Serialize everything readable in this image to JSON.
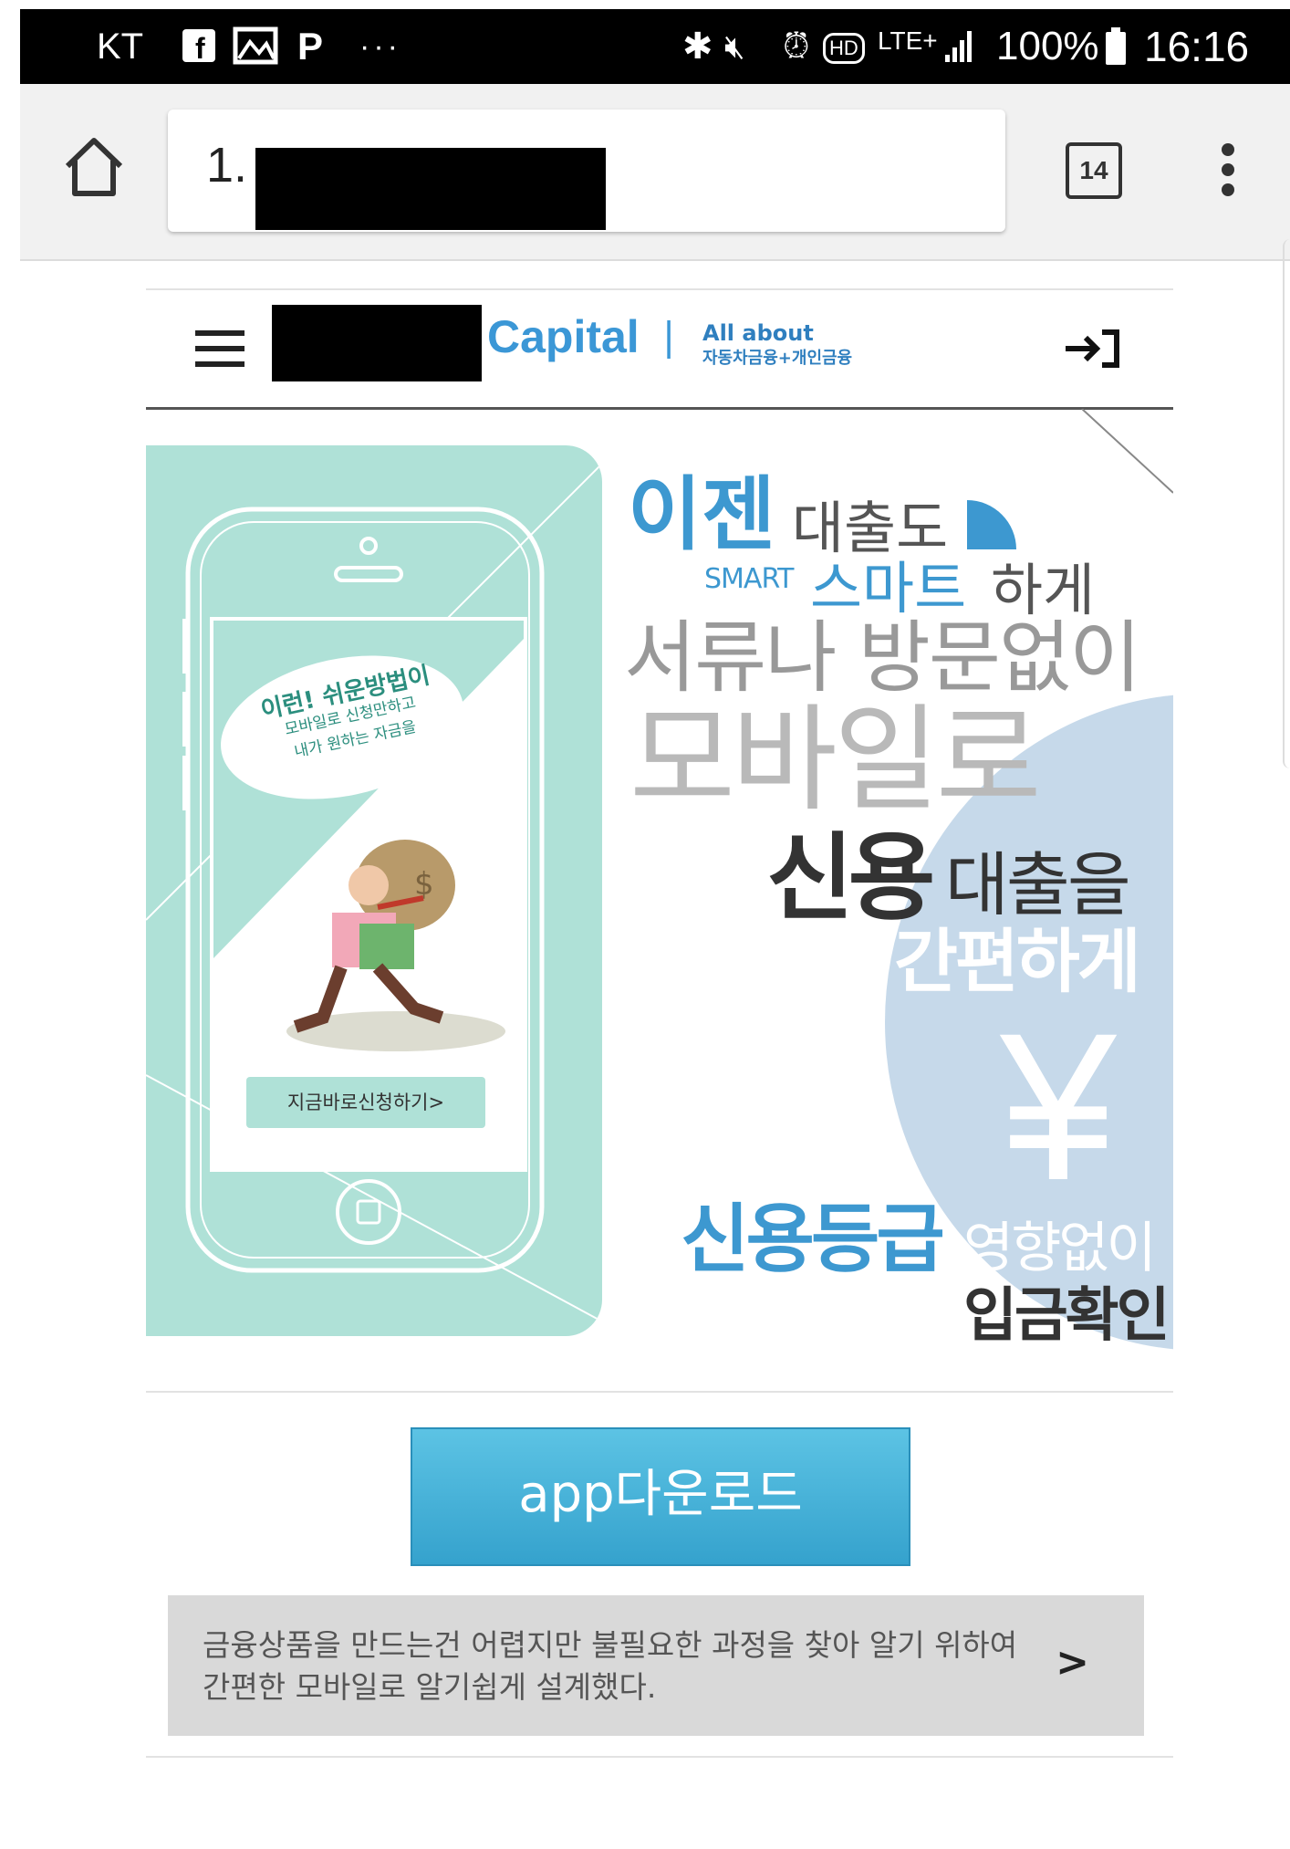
{
  "status_bar": {
    "carrier": "KT",
    "notif_icons": [
      "facebook-icon",
      "gallery-icon",
      "p-icon"
    ],
    "more": "···",
    "network": "LTE+",
    "battery": "100%",
    "time": "16:16"
  },
  "browser": {
    "url_text": "1.",
    "tab_count": "14"
  },
  "site": {
    "brand": "Capital",
    "separator": "|",
    "tagline_top": "All about",
    "tagline_bottom": "자동차금융+개인금융"
  },
  "banner": {
    "phone_bubble": [
      "이런! 쉬운방법이",
      "모바일로 신청만하고",
      "내가 원하는 자금을"
    ],
    "phone_button": "지금바로신청하기>",
    "line_ijen": "이젠",
    "line_loan_too": "대출도",
    "line_smart_en": "SMART",
    "line_smart_kr": "스마트",
    "line_hage": "하게",
    "line_no_docs": "서류나 방문없이",
    "line_mobile": "모바일로",
    "line_credit": "신용",
    "line_credit_loan": "대출을",
    "line_easy": "간편하게",
    "yen_symbol": "¥",
    "line_grade": "신용등급",
    "line_no_effect": "영향없이",
    "line_deposit": "입금확인"
  },
  "download_button": "app다운로드",
  "info_box": {
    "text": "금융상품을 만드는건 어렵지만 불필요한 과정을 찾아 알기 위하여 간편한 모바일로 알기쉽게  설계했다.",
    "arrow": ">"
  },
  "colors": {
    "mint": "#afe1d7",
    "accent_blue": "#3b97d6",
    "button_blue": "#45b0d9",
    "circle_blue": "#c6d9ea"
  }
}
